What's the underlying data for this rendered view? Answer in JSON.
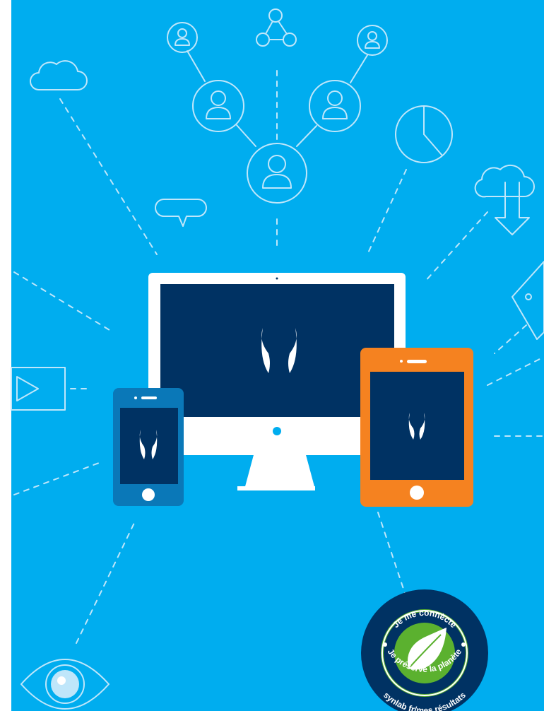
{
  "colors": {
    "background": "#00adef",
    "line": "#bfe6fa",
    "navy": "#003263",
    "white": "#ffffff",
    "orange": "#f58220",
    "phone_blue": "#0a78b8",
    "badge_green": "#5bb12f"
  },
  "icons": [
    "cloud-icon",
    "person-icon",
    "share-icon",
    "pie-chart-icon",
    "chat-bubble-icon",
    "cloud-download-icon",
    "tag-icon",
    "video-play-icon",
    "eye-icon",
    "logo-icon"
  ],
  "badge": {
    "top_text": "Je me connècte",
    "middle_text": "Je préserve la planète",
    "bottom_text": "synlab fr/mes résultats"
  }
}
